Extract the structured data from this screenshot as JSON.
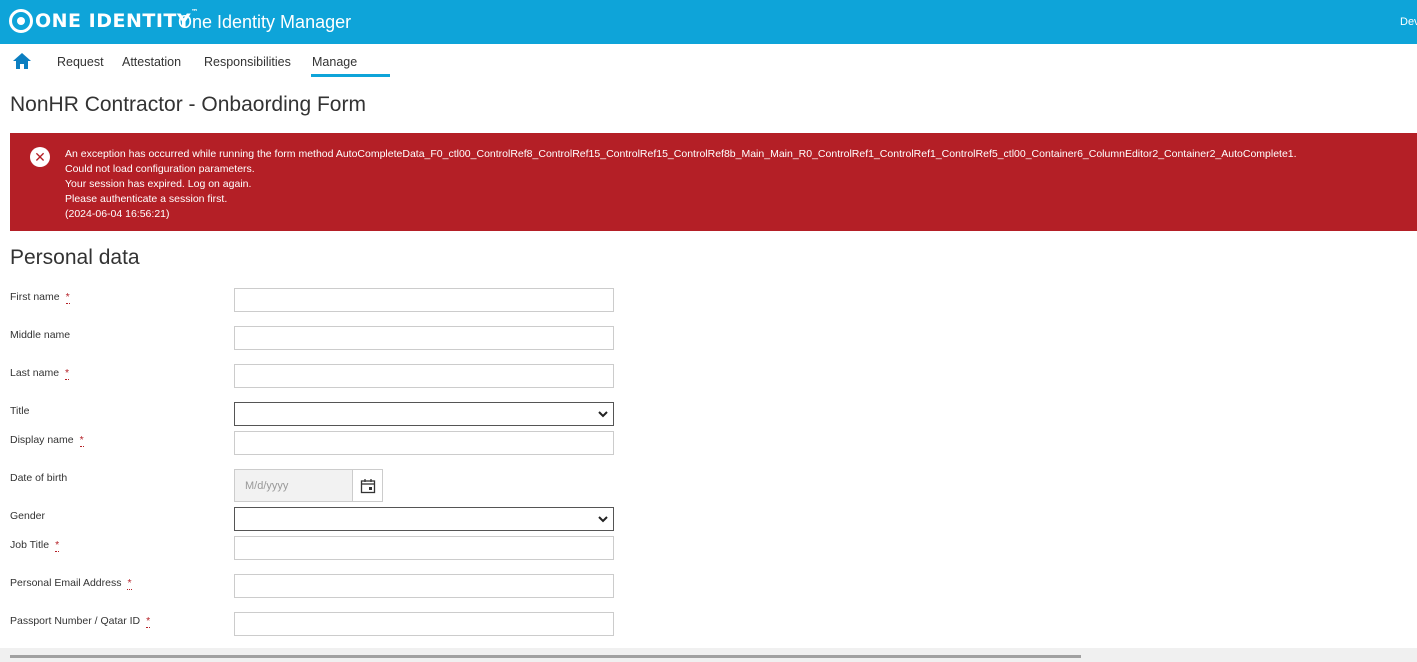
{
  "header": {
    "logo_text": "ONE IDENTITY",
    "logo_tm": "™",
    "app_title": "One Identity Manager",
    "user": "Dev"
  },
  "colors": {
    "brand": "#0ea4d9",
    "error": "#b41f26"
  },
  "nav": {
    "home_icon": "home-icon",
    "items": [
      {
        "label": "Request"
      },
      {
        "label": "Attestation"
      },
      {
        "label": "Responsibilities"
      },
      {
        "label": "Manage"
      }
    ],
    "active": "Manage"
  },
  "page": {
    "title": "NonHR Contractor - Onbaording Form"
  },
  "error": {
    "icon": "error-x-icon",
    "lines": [
      "An exception has occurred while running the form method AutoCompleteData_F0_ctl00_ControlRef8_ControlRef15_ControlRef15_ControlRef8b_Main_Main_R0_ControlRef1_ControlRef1_ControlRef5_ctl00_Container6_ColumnEditor2_Container2_AutoComplete1.",
      "Could not load configuration parameters.",
      "Your session has expired. Log on again.",
      "Please authenticate a session first.",
      "(2024-06-04 16:56:21)"
    ]
  },
  "form": {
    "section_title": "Personal data",
    "required_marker": "*",
    "fields": [
      {
        "label": "First name",
        "value": ""
      },
      {
        "label": "Middle name",
        "value": ""
      },
      {
        "label": "Last name",
        "value": ""
      },
      {
        "label": "Title",
        "value": ""
      },
      {
        "label": "Display name",
        "value": ""
      },
      {
        "label": "Date of birth",
        "placeholder": "M/d/yyyy"
      },
      {
        "label": "Gender",
        "value": ""
      },
      {
        "label": "Job Title",
        "value": ""
      },
      {
        "label": "Personal Email Address",
        "value": ""
      },
      {
        "label": "Passport Number / Qatar ID",
        "value": ""
      }
    ]
  }
}
